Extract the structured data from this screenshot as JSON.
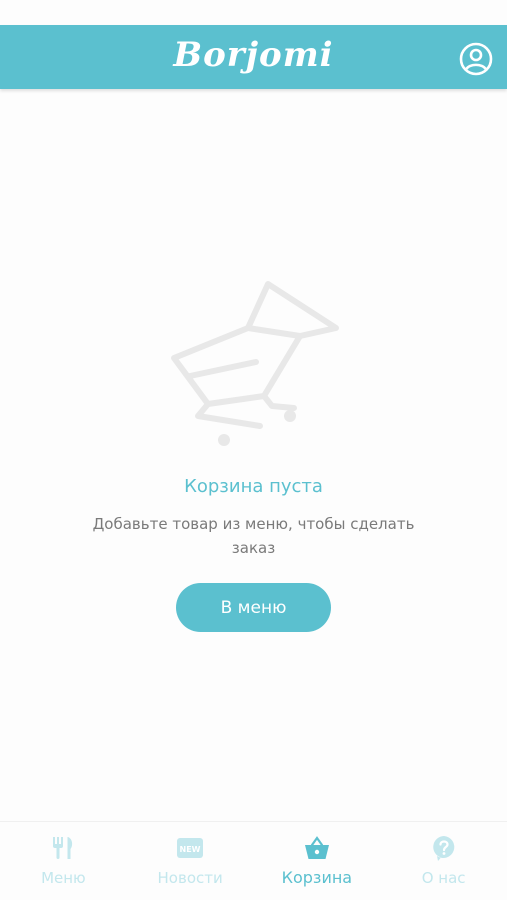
{
  "header": {
    "logo_text": "Borjomi",
    "brand_color": "#5bc0cf",
    "profile_icon": "user-circle-icon"
  },
  "empty_state": {
    "illustration": "shopping-cart-icon",
    "title": "Корзина пуста",
    "subtitle": "Добавьте товар из меню, чтобы сделать заказ",
    "button_label": "В меню"
  },
  "bottom_nav": {
    "items": [
      {
        "label": "Меню",
        "icon": "fork-knife-icon",
        "active": false
      },
      {
        "label": "Новости",
        "icon": "new-badge-icon",
        "active": false
      },
      {
        "label": "Корзина",
        "icon": "basket-icon",
        "active": true
      },
      {
        "label": "О нас",
        "icon": "question-bubble-icon",
        "active": false
      }
    ],
    "active_color": "#5bc0cf",
    "inactive_color": "#c3e7ed"
  }
}
